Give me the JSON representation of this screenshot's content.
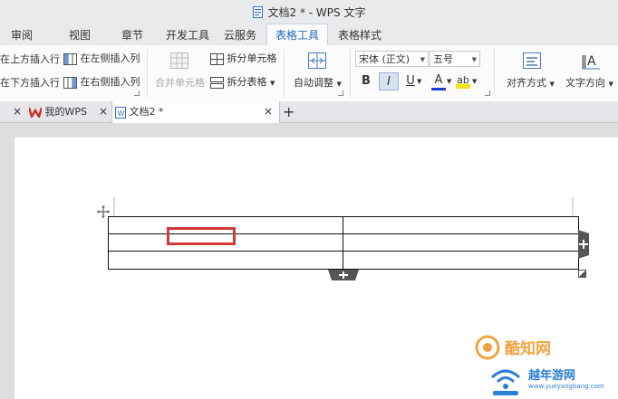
{
  "window": {
    "title": "文档2 * - WPS 文字"
  },
  "menu_tabs": [
    {
      "label": "审阅"
    },
    {
      "label": "视图"
    },
    {
      "label": "章节"
    },
    {
      "label": "开发工具"
    },
    {
      "label": "云服务"
    },
    {
      "label": "表格工具"
    },
    {
      "label": "表格样式"
    }
  ],
  "active_tab": "表格工具",
  "ribbon": {
    "insert_row_above": "在上方插入行",
    "insert_row_below": "在下方插入行",
    "insert_col_left": "在左侧插入列",
    "insert_col_right": "在右侧插入列",
    "merge_cells": "合并单元格",
    "split_cells": "拆分单元格",
    "split_table": "拆分表格",
    "auto_fit": "自动调整",
    "font_name": "宋体 (正文)",
    "font_size": "五号",
    "bold": "B",
    "italic": "I",
    "underline": "U",
    "font_color": "A",
    "highlight": "ab",
    "align": "对齐方式",
    "text_direction": "文字方向"
  },
  "doc_tabs": {
    "mywps": "我的WPS",
    "doc2": "文档2 *",
    "add": "+"
  },
  "watermark": {
    "top": "酷知网",
    "bottom": "越年游网",
    "url": "www.yueyangbang.com"
  },
  "colors": {
    "accent": "#1d6bc1",
    "selected_cell_border": "#d23a3a",
    "wps_red": "#d0282e"
  }
}
